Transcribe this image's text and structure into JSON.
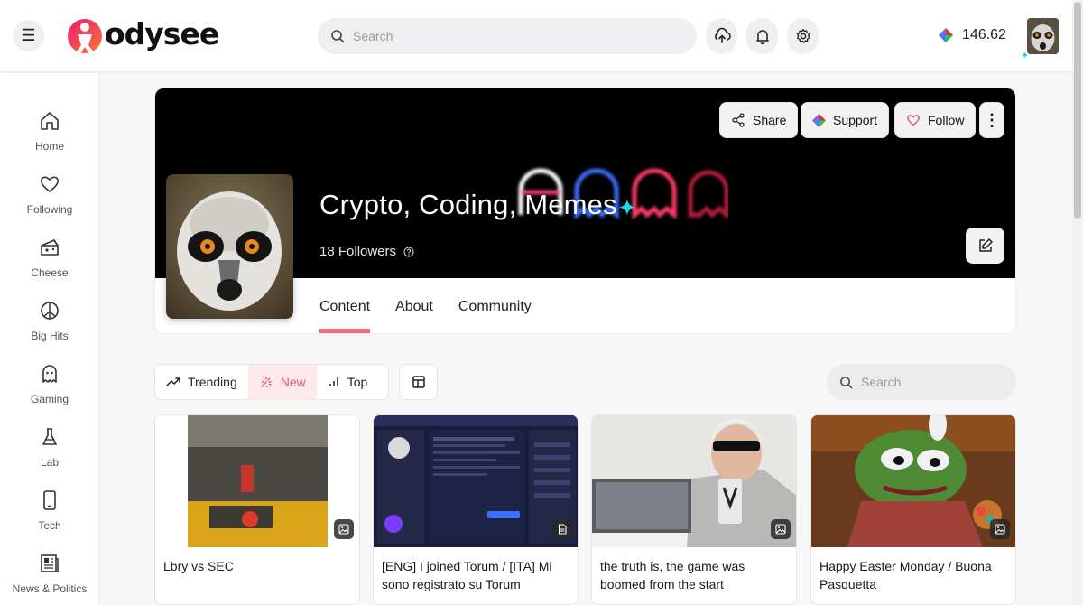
{
  "header": {
    "logo_text": "odysee",
    "search_placeholder": "Search",
    "balance": "146.62",
    "icons": [
      "menu-icon",
      "upload-icon",
      "bell-icon",
      "gear-icon",
      "credits-icon"
    ]
  },
  "sidebar": {
    "items": [
      {
        "label": "Home",
        "icon": "home-icon"
      },
      {
        "label": "Following",
        "icon": "heart-icon"
      },
      {
        "label": "Cheese",
        "icon": "cheese-icon"
      },
      {
        "label": "Big Hits",
        "icon": "peace-icon"
      },
      {
        "label": "Gaming",
        "icon": "ghost-icon"
      },
      {
        "label": "Lab",
        "icon": "flask-icon"
      },
      {
        "label": "Tech",
        "icon": "phone-icon"
      },
      {
        "label": "News & Politics",
        "icon": "newspaper-icon"
      }
    ]
  },
  "channel": {
    "title": "Crypto, Coding, Memes",
    "followers": "18 Followers",
    "share_label": "Share",
    "support_label": "Support",
    "follow_label": "Follow",
    "tabs": [
      {
        "label": "Content",
        "active": true
      },
      {
        "label": "About",
        "active": false
      },
      {
        "label": "Community",
        "active": false
      }
    ]
  },
  "filters": {
    "items": [
      {
        "label": "Trending",
        "icon": "trending-icon",
        "active": false
      },
      {
        "label": "New",
        "icon": "sparkle-icon",
        "active": true
      },
      {
        "label": "Top",
        "icon": "bar-chart-icon",
        "active": false
      }
    ],
    "search_placeholder": "Search"
  },
  "cards": [
    {
      "title": "Lbry vs SEC",
      "badge": "image-icon"
    },
    {
      "title": "[ENG] I joined Torum / [ITA] Mi sono registrato su Torum",
      "badge": "document-icon"
    },
    {
      "title": "the truth is, the game was boomed from the start",
      "badge": "image-icon"
    },
    {
      "title": "Happy Easter Monday / Buona Pasquetta",
      "badge": "image-icon"
    }
  ],
  "colors": {
    "accent": "#f16b7a",
    "accent_bg": "#fde9ec",
    "cover_bg": "#000000",
    "sparkle": "#19d8e6"
  }
}
